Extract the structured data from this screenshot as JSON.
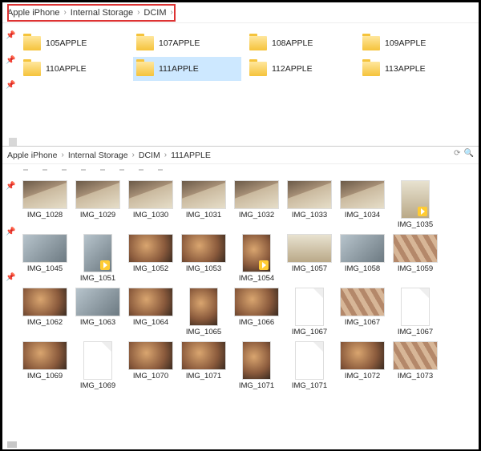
{
  "top": {
    "breadcrumb": [
      "Apple iPhone",
      "Internal Storage",
      "DCIM"
    ],
    "folders": [
      {
        "name": "105APPLE",
        "selected": false
      },
      {
        "name": "107APPLE",
        "selected": false
      },
      {
        "name": "108APPLE",
        "selected": false
      },
      {
        "name": "109APPLE",
        "selected": false
      },
      {
        "name": "110APPLE",
        "selected": false
      },
      {
        "name": "111APPLE",
        "selected": true
      },
      {
        "name": "112APPLE",
        "selected": false
      },
      {
        "name": "113APPLE",
        "selected": false
      }
    ]
  },
  "bottom": {
    "breadcrumb": [
      "Apple iPhone",
      "Internal Storage",
      "DCIM",
      "111APPLE"
    ],
    "thumbnails": [
      {
        "name": "IMG_1028",
        "style": "p-a",
        "shape": "l"
      },
      {
        "name": "IMG_1029",
        "style": "p-a",
        "shape": "l"
      },
      {
        "name": "IMG_1030",
        "style": "p-a",
        "shape": "l"
      },
      {
        "name": "IMG_1031",
        "style": "p-a",
        "shape": "l"
      },
      {
        "name": "IMG_1032",
        "style": "p-a",
        "shape": "l"
      },
      {
        "name": "IMG_1033",
        "style": "p-a",
        "shape": "l"
      },
      {
        "name": "IMG_1034",
        "style": "p-a",
        "shape": "l"
      },
      {
        "name": "IMG_1035",
        "style": "p-d",
        "shape": "p",
        "video": true
      },
      {
        "name": "IMG_1045",
        "style": "p-c",
        "shape": "l"
      },
      {
        "name": "IMG_1051",
        "style": "p-c",
        "shape": "p",
        "video": true
      },
      {
        "name": "IMG_1052",
        "style": "p-b",
        "shape": "l"
      },
      {
        "name": "IMG_1053",
        "style": "p-b",
        "shape": "l"
      },
      {
        "name": "IMG_1054",
        "style": "p-b",
        "shape": "p",
        "video": true
      },
      {
        "name": "IMG_1057",
        "style": "p-d",
        "shape": "l"
      },
      {
        "name": "IMG_1058",
        "style": "p-c",
        "shape": "l"
      },
      {
        "name": "IMG_1059",
        "style": "p-e",
        "shape": "l"
      },
      {
        "name": "IMG_1062",
        "style": "p-b",
        "shape": "l"
      },
      {
        "name": "IMG_1063",
        "style": "p-c",
        "shape": "l"
      },
      {
        "name": "IMG_1064",
        "style": "p-b",
        "shape": "l"
      },
      {
        "name": "IMG_1065",
        "style": "p-b",
        "shape": "p"
      },
      {
        "name": "IMG_1066",
        "style": "p-b",
        "shape": "l"
      },
      {
        "name": "IMG_1067",
        "style": "blank",
        "shape": "p"
      },
      {
        "name": "IMG_1067",
        "style": "p-e",
        "shape": "l"
      },
      {
        "name": "IMG_1067",
        "style": "blank",
        "shape": "p"
      },
      {
        "name": "IMG_1069",
        "style": "p-b",
        "shape": "l"
      },
      {
        "name": "IMG_1069",
        "style": "blank",
        "shape": "p"
      },
      {
        "name": "IMG_1070",
        "style": "p-b",
        "shape": "l"
      },
      {
        "name": "IMG_1071",
        "style": "p-b",
        "shape": "l"
      },
      {
        "name": "IMG_1071",
        "style": "p-b",
        "shape": "p"
      },
      {
        "name": "IMG_1071",
        "style": "blank",
        "shape": "p"
      },
      {
        "name": "IMG_1072",
        "style": "p-b",
        "shape": "l"
      },
      {
        "name": "IMG_1073",
        "style": "p-e",
        "shape": "l"
      }
    ]
  }
}
